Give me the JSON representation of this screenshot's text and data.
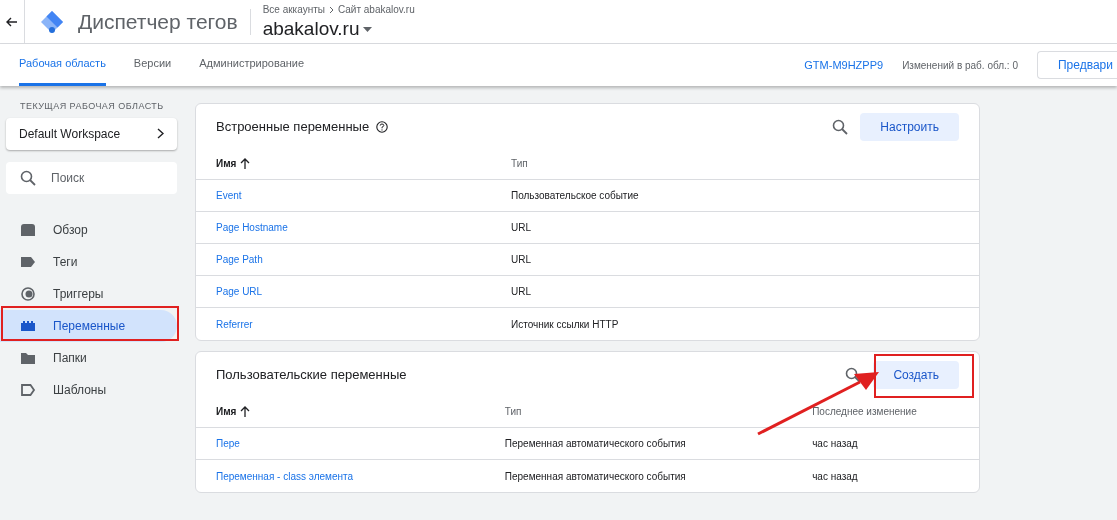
{
  "header": {
    "app_title": "Диспетчер тегов",
    "breadcrumb": [
      "Все аккаунты",
      "Сайт abakalov.ru"
    ],
    "container": "abakalov.ru"
  },
  "tabs": [
    {
      "label": "Рабочая область",
      "selected": true
    },
    {
      "label": "Версии",
      "selected": false
    },
    {
      "label": "Администрирование",
      "selected": false
    }
  ],
  "container_id": "GTM-M9HZPP9",
  "changes": "Изменений в раб. обл.: 0",
  "preview_button": "Предвари",
  "sidebar": {
    "workspace_label": "ТЕКУЩАЯ РАБОЧАЯ ОБЛАСТЬ",
    "workspace": "Default Workspace",
    "search": {
      "placeholder": "Поиск"
    },
    "items": [
      {
        "kind": "overview",
        "label": "Обзор",
        "selected": false
      },
      {
        "kind": "tags",
        "label": "Теги",
        "selected": false
      },
      {
        "kind": "triggers",
        "label": "Триггеры",
        "selected": false
      },
      {
        "kind": "variables",
        "label": "Переменные",
        "selected": true
      },
      {
        "kind": "folders",
        "label": "Папки",
        "selected": false
      },
      {
        "kind": "templates",
        "label": "Шаблоны",
        "selected": false
      }
    ]
  },
  "builtin": {
    "title": "Встроенные переменные",
    "button": "Настроить",
    "columns": [
      "Имя",
      "Тип"
    ],
    "rows": [
      [
        "Event",
        "Пользовательское событие"
      ],
      [
        "Page Hostname",
        "URL"
      ],
      [
        "Page Path",
        "URL"
      ],
      [
        "Page URL",
        "URL"
      ],
      [
        "Referrer",
        "Источник ссылки HTTP"
      ]
    ]
  },
  "custom": {
    "title": "Пользовательские переменные",
    "button": "Создать",
    "columns": [
      "Имя",
      "Тип",
      "Последнее изменение"
    ],
    "rows": [
      [
        "Пере",
        "Переменная автоматического события",
        "час назад"
      ],
      [
        "Переменная - class элемента",
        "Переменная автоматического события",
        "час назад"
      ]
    ]
  }
}
